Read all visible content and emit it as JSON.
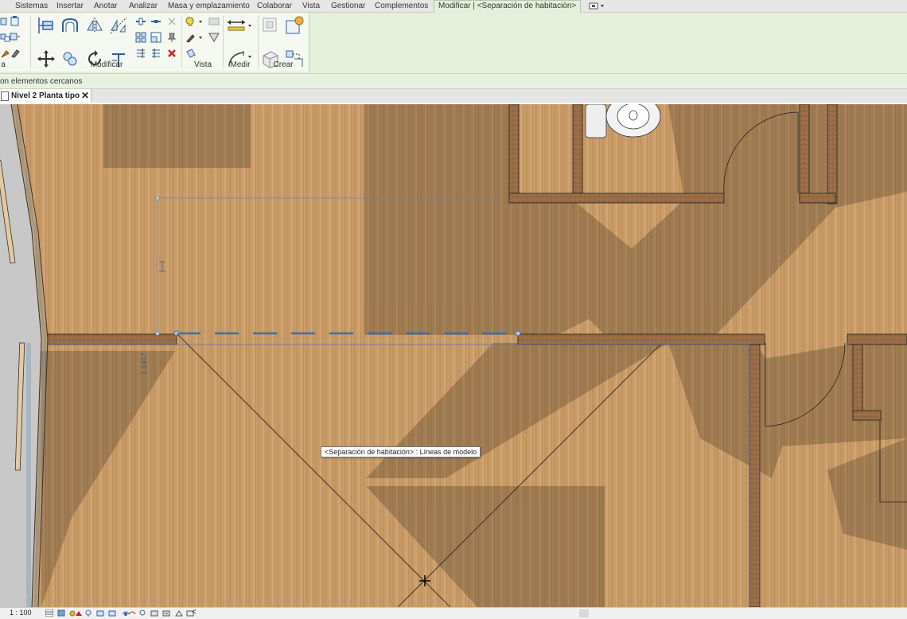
{
  "menu": {
    "tabs": [
      "Sistemas",
      "Insertar",
      "Anotar",
      "Analizar",
      "Masa y emplazamiento",
      "Colaborar",
      "Vista",
      "Gestionar",
      "Complementos",
      "Modificar | <Separación de habitación>"
    ]
  },
  "ribbon": {
    "panels": [
      "Modificar",
      "Vista",
      "Medir",
      "Crear"
    ],
    "left_fragment": "a"
  },
  "options_bar": {
    "text": "on elementos cercanos"
  },
  "view": {
    "tab_label": "Nivel 2 Planta tipo",
    "close_glyph": "✕"
  },
  "canvas": {
    "tooltip": "<Separación de habitación> : Líneas de modelo",
    "dimension_label": "1.1417"
  },
  "status": {
    "scale": "1 : 100",
    "collapse_glyph": "<"
  },
  "colors": {
    "ribbon_bg": "#e4f0da",
    "floor_wood": "#c99c69",
    "selection_blue": "#3a6fb0",
    "wall_brick": "#a0754e"
  }
}
